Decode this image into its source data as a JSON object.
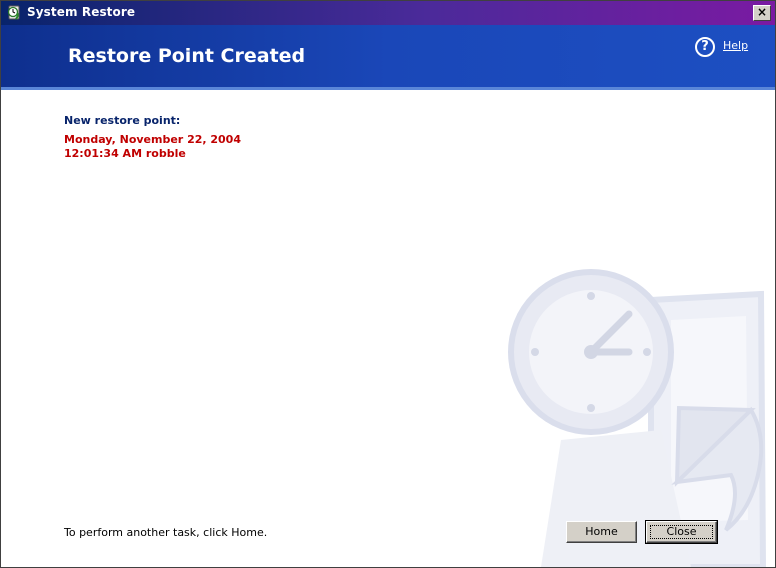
{
  "window": {
    "title": "System Restore",
    "close_glyph": "×"
  },
  "header": {
    "title": "Restore Point Created",
    "help_glyph": "?",
    "help_label": "Help"
  },
  "main": {
    "new_point_label": "New restore point:",
    "restore_date": "Monday, November 22, 2004",
    "restore_time_user": "12:01:34 AM  robble",
    "footer_instruction": "To perform another task, click Home."
  },
  "buttons": {
    "home_label": "Home",
    "close_label": "Close"
  },
  "icons": {
    "app": "system-restore-icon",
    "help": "help-icon",
    "watermark": "clock-restore-watermark"
  },
  "colors": {
    "title_bar_start": "#08246b",
    "title_bar_end": "#7a1aa2",
    "header_bg": "#1a47b8",
    "label_color": "#08246b",
    "restore_point_color": "#c00000"
  }
}
